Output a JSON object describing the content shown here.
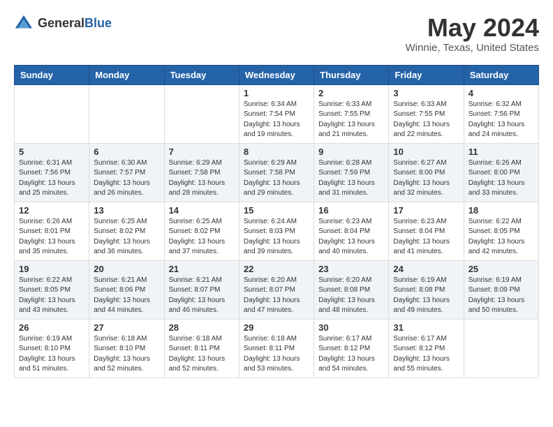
{
  "header": {
    "logo_general": "General",
    "logo_blue": "Blue",
    "month_year": "May 2024",
    "location": "Winnie, Texas, United States"
  },
  "calendar": {
    "days_of_week": [
      "Sunday",
      "Monday",
      "Tuesday",
      "Wednesday",
      "Thursday",
      "Friday",
      "Saturday"
    ],
    "weeks": [
      [
        {
          "day": "",
          "info": ""
        },
        {
          "day": "",
          "info": ""
        },
        {
          "day": "",
          "info": ""
        },
        {
          "day": "1",
          "info": "Sunrise: 6:34 AM\nSunset: 7:54 PM\nDaylight: 13 hours\nand 19 minutes."
        },
        {
          "day": "2",
          "info": "Sunrise: 6:33 AM\nSunset: 7:55 PM\nDaylight: 13 hours\nand 21 minutes."
        },
        {
          "day": "3",
          "info": "Sunrise: 6:33 AM\nSunset: 7:55 PM\nDaylight: 13 hours\nand 22 minutes."
        },
        {
          "day": "4",
          "info": "Sunrise: 6:32 AM\nSunset: 7:56 PM\nDaylight: 13 hours\nand 24 minutes."
        }
      ],
      [
        {
          "day": "5",
          "info": "Sunrise: 6:31 AM\nSunset: 7:56 PM\nDaylight: 13 hours\nand 25 minutes."
        },
        {
          "day": "6",
          "info": "Sunrise: 6:30 AM\nSunset: 7:57 PM\nDaylight: 13 hours\nand 26 minutes."
        },
        {
          "day": "7",
          "info": "Sunrise: 6:29 AM\nSunset: 7:58 PM\nDaylight: 13 hours\nand 28 minutes."
        },
        {
          "day": "8",
          "info": "Sunrise: 6:29 AM\nSunset: 7:58 PM\nDaylight: 13 hours\nand 29 minutes."
        },
        {
          "day": "9",
          "info": "Sunrise: 6:28 AM\nSunset: 7:59 PM\nDaylight: 13 hours\nand 31 minutes."
        },
        {
          "day": "10",
          "info": "Sunrise: 6:27 AM\nSunset: 8:00 PM\nDaylight: 13 hours\nand 32 minutes."
        },
        {
          "day": "11",
          "info": "Sunrise: 6:26 AM\nSunset: 8:00 PM\nDaylight: 13 hours\nand 33 minutes."
        }
      ],
      [
        {
          "day": "12",
          "info": "Sunrise: 6:26 AM\nSunset: 8:01 PM\nDaylight: 13 hours\nand 35 minutes."
        },
        {
          "day": "13",
          "info": "Sunrise: 6:25 AM\nSunset: 8:02 PM\nDaylight: 13 hours\nand 36 minutes."
        },
        {
          "day": "14",
          "info": "Sunrise: 6:25 AM\nSunset: 8:02 PM\nDaylight: 13 hours\nand 37 minutes."
        },
        {
          "day": "15",
          "info": "Sunrise: 6:24 AM\nSunset: 8:03 PM\nDaylight: 13 hours\nand 39 minutes."
        },
        {
          "day": "16",
          "info": "Sunrise: 6:23 AM\nSunset: 8:04 PM\nDaylight: 13 hours\nand 40 minutes."
        },
        {
          "day": "17",
          "info": "Sunrise: 6:23 AM\nSunset: 8:04 PM\nDaylight: 13 hours\nand 41 minutes."
        },
        {
          "day": "18",
          "info": "Sunrise: 6:22 AM\nSunset: 8:05 PM\nDaylight: 13 hours\nand 42 minutes."
        }
      ],
      [
        {
          "day": "19",
          "info": "Sunrise: 6:22 AM\nSunset: 8:05 PM\nDaylight: 13 hours\nand 43 minutes."
        },
        {
          "day": "20",
          "info": "Sunrise: 6:21 AM\nSunset: 8:06 PM\nDaylight: 13 hours\nand 44 minutes."
        },
        {
          "day": "21",
          "info": "Sunrise: 6:21 AM\nSunset: 8:07 PM\nDaylight: 13 hours\nand 46 minutes."
        },
        {
          "day": "22",
          "info": "Sunrise: 6:20 AM\nSunset: 8:07 PM\nDaylight: 13 hours\nand 47 minutes."
        },
        {
          "day": "23",
          "info": "Sunrise: 6:20 AM\nSunset: 8:08 PM\nDaylight: 13 hours\nand 48 minutes."
        },
        {
          "day": "24",
          "info": "Sunrise: 6:19 AM\nSunset: 8:08 PM\nDaylight: 13 hours\nand 49 minutes."
        },
        {
          "day": "25",
          "info": "Sunrise: 6:19 AM\nSunset: 8:09 PM\nDaylight: 13 hours\nand 50 minutes."
        }
      ],
      [
        {
          "day": "26",
          "info": "Sunrise: 6:19 AM\nSunset: 8:10 PM\nDaylight: 13 hours\nand 51 minutes."
        },
        {
          "day": "27",
          "info": "Sunrise: 6:18 AM\nSunset: 8:10 PM\nDaylight: 13 hours\nand 52 minutes."
        },
        {
          "day": "28",
          "info": "Sunrise: 6:18 AM\nSunset: 8:11 PM\nDaylight: 13 hours\nand 52 minutes."
        },
        {
          "day": "29",
          "info": "Sunrise: 6:18 AM\nSunset: 8:11 PM\nDaylight: 13 hours\nand 53 minutes."
        },
        {
          "day": "30",
          "info": "Sunrise: 6:17 AM\nSunset: 8:12 PM\nDaylight: 13 hours\nand 54 minutes."
        },
        {
          "day": "31",
          "info": "Sunrise: 6:17 AM\nSunset: 8:12 PM\nDaylight: 13 hours\nand 55 minutes."
        },
        {
          "day": "",
          "info": ""
        }
      ]
    ]
  }
}
